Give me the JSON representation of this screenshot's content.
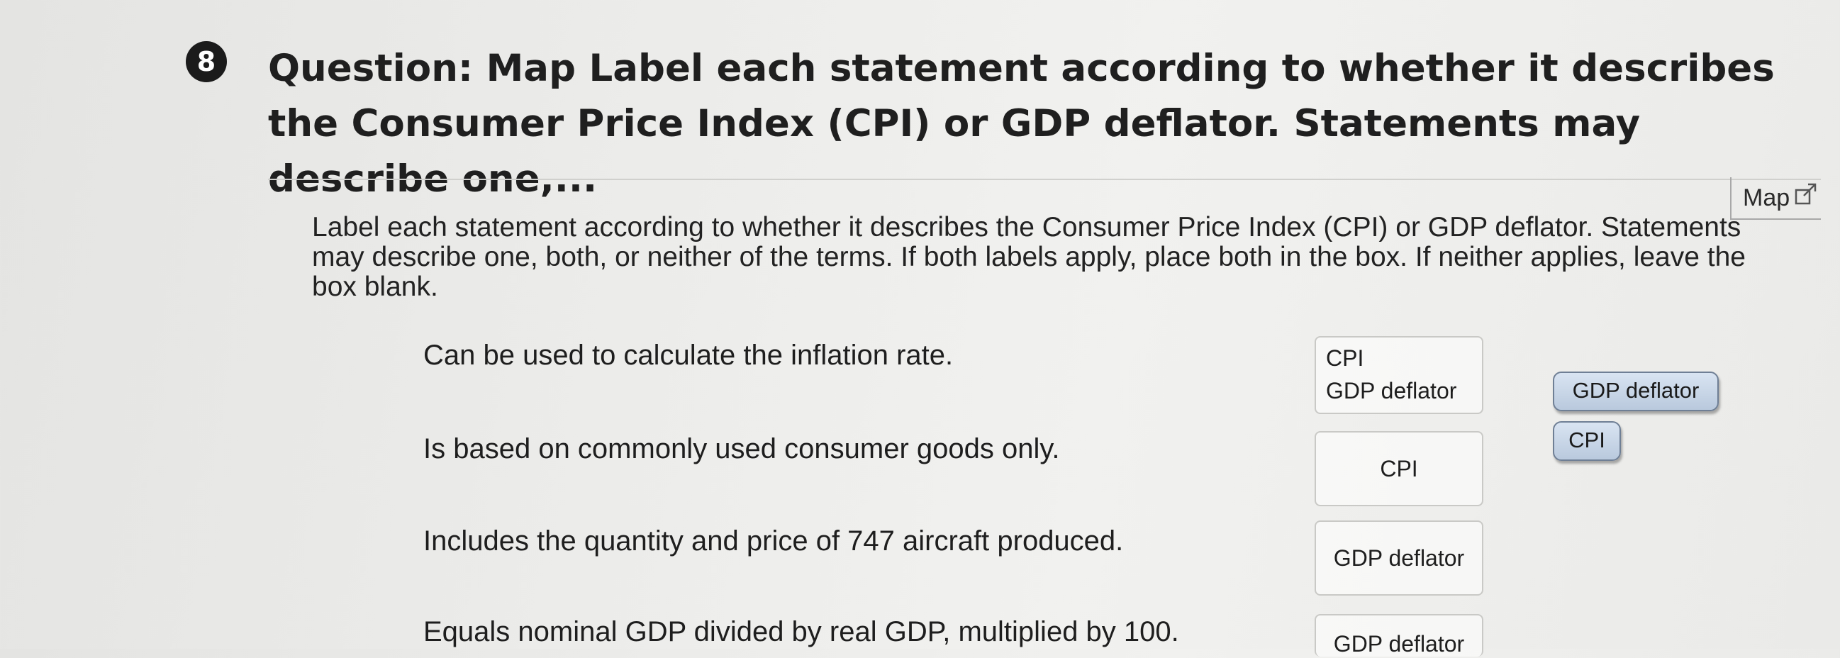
{
  "question": {
    "number": "8",
    "title": "Question: Map Label each statement according to whether it describes the Consumer Price Index (CPI) or GDP deflator. Statements may describe one,..."
  },
  "map_link": {
    "label": "Map",
    "icon": "external-link-icon"
  },
  "instructions": "Label each statement according to whether it describes the Consumer Price Index (CPI) or GDP deflator. Statements may describe one, both, or neither of the terms. If both labels apply, place both in the box. If neither applies, leave the box blank.",
  "statements": [
    {
      "text": "Can be used to calculate the inflation rate.",
      "labels": [
        "CPI",
        "GDP deflator"
      ]
    },
    {
      "text": "Is based on commonly used consumer goods only.",
      "labels": [
        "CPI"
      ]
    },
    {
      "text": "Includes the quantity and price of 747 aircraft produced.",
      "labels": [
        "GDP deflator"
      ]
    },
    {
      "text": "Equals nominal GDP divided by real GDP, multiplied by 100.",
      "labels": [
        "GDP deflator"
      ]
    }
  ],
  "label_bank": [
    "GDP deflator",
    "CPI"
  ]
}
